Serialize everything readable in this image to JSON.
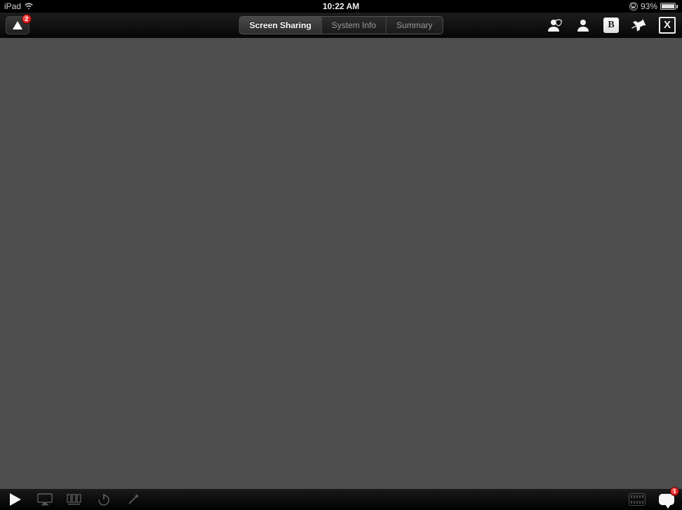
{
  "status_bar": {
    "device": "iPad",
    "time": "10:22 AM",
    "battery_percent": "93%"
  },
  "toolbar": {
    "app_badge_count": "2",
    "tabs": {
      "screen_sharing": "Screen Sharing",
      "system_info": "System Info",
      "summary": "Summary"
    },
    "b_label": "B",
    "x_label": "X"
  },
  "bottom": {
    "chat_badge": "1"
  }
}
